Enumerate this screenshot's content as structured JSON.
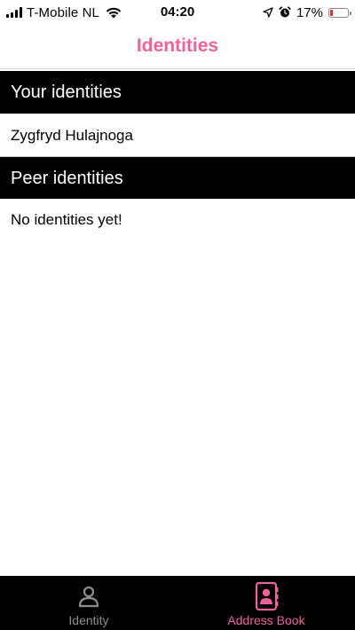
{
  "status_bar": {
    "carrier": "T-Mobile NL",
    "time": "04:20",
    "battery_percent": "17%",
    "battery_level": 0.17
  },
  "nav": {
    "title": "Identities"
  },
  "sections": {
    "your_identities": {
      "header": "Your identities",
      "items": [
        "Zygfryd Hulajnoga"
      ]
    },
    "peer_identities": {
      "header": "Peer identities",
      "empty_text": "No identities yet!"
    }
  },
  "tab_bar": {
    "tabs": [
      {
        "label": "Identity",
        "icon": "person-icon",
        "active": false
      },
      {
        "label": "Address Book",
        "icon": "address-book-icon",
        "active": true
      }
    ]
  },
  "colors": {
    "accent": "#f0609a",
    "inactive_tab": "#8e8e8e",
    "header_bg": "#000000",
    "battery_low": "#e0282e"
  }
}
